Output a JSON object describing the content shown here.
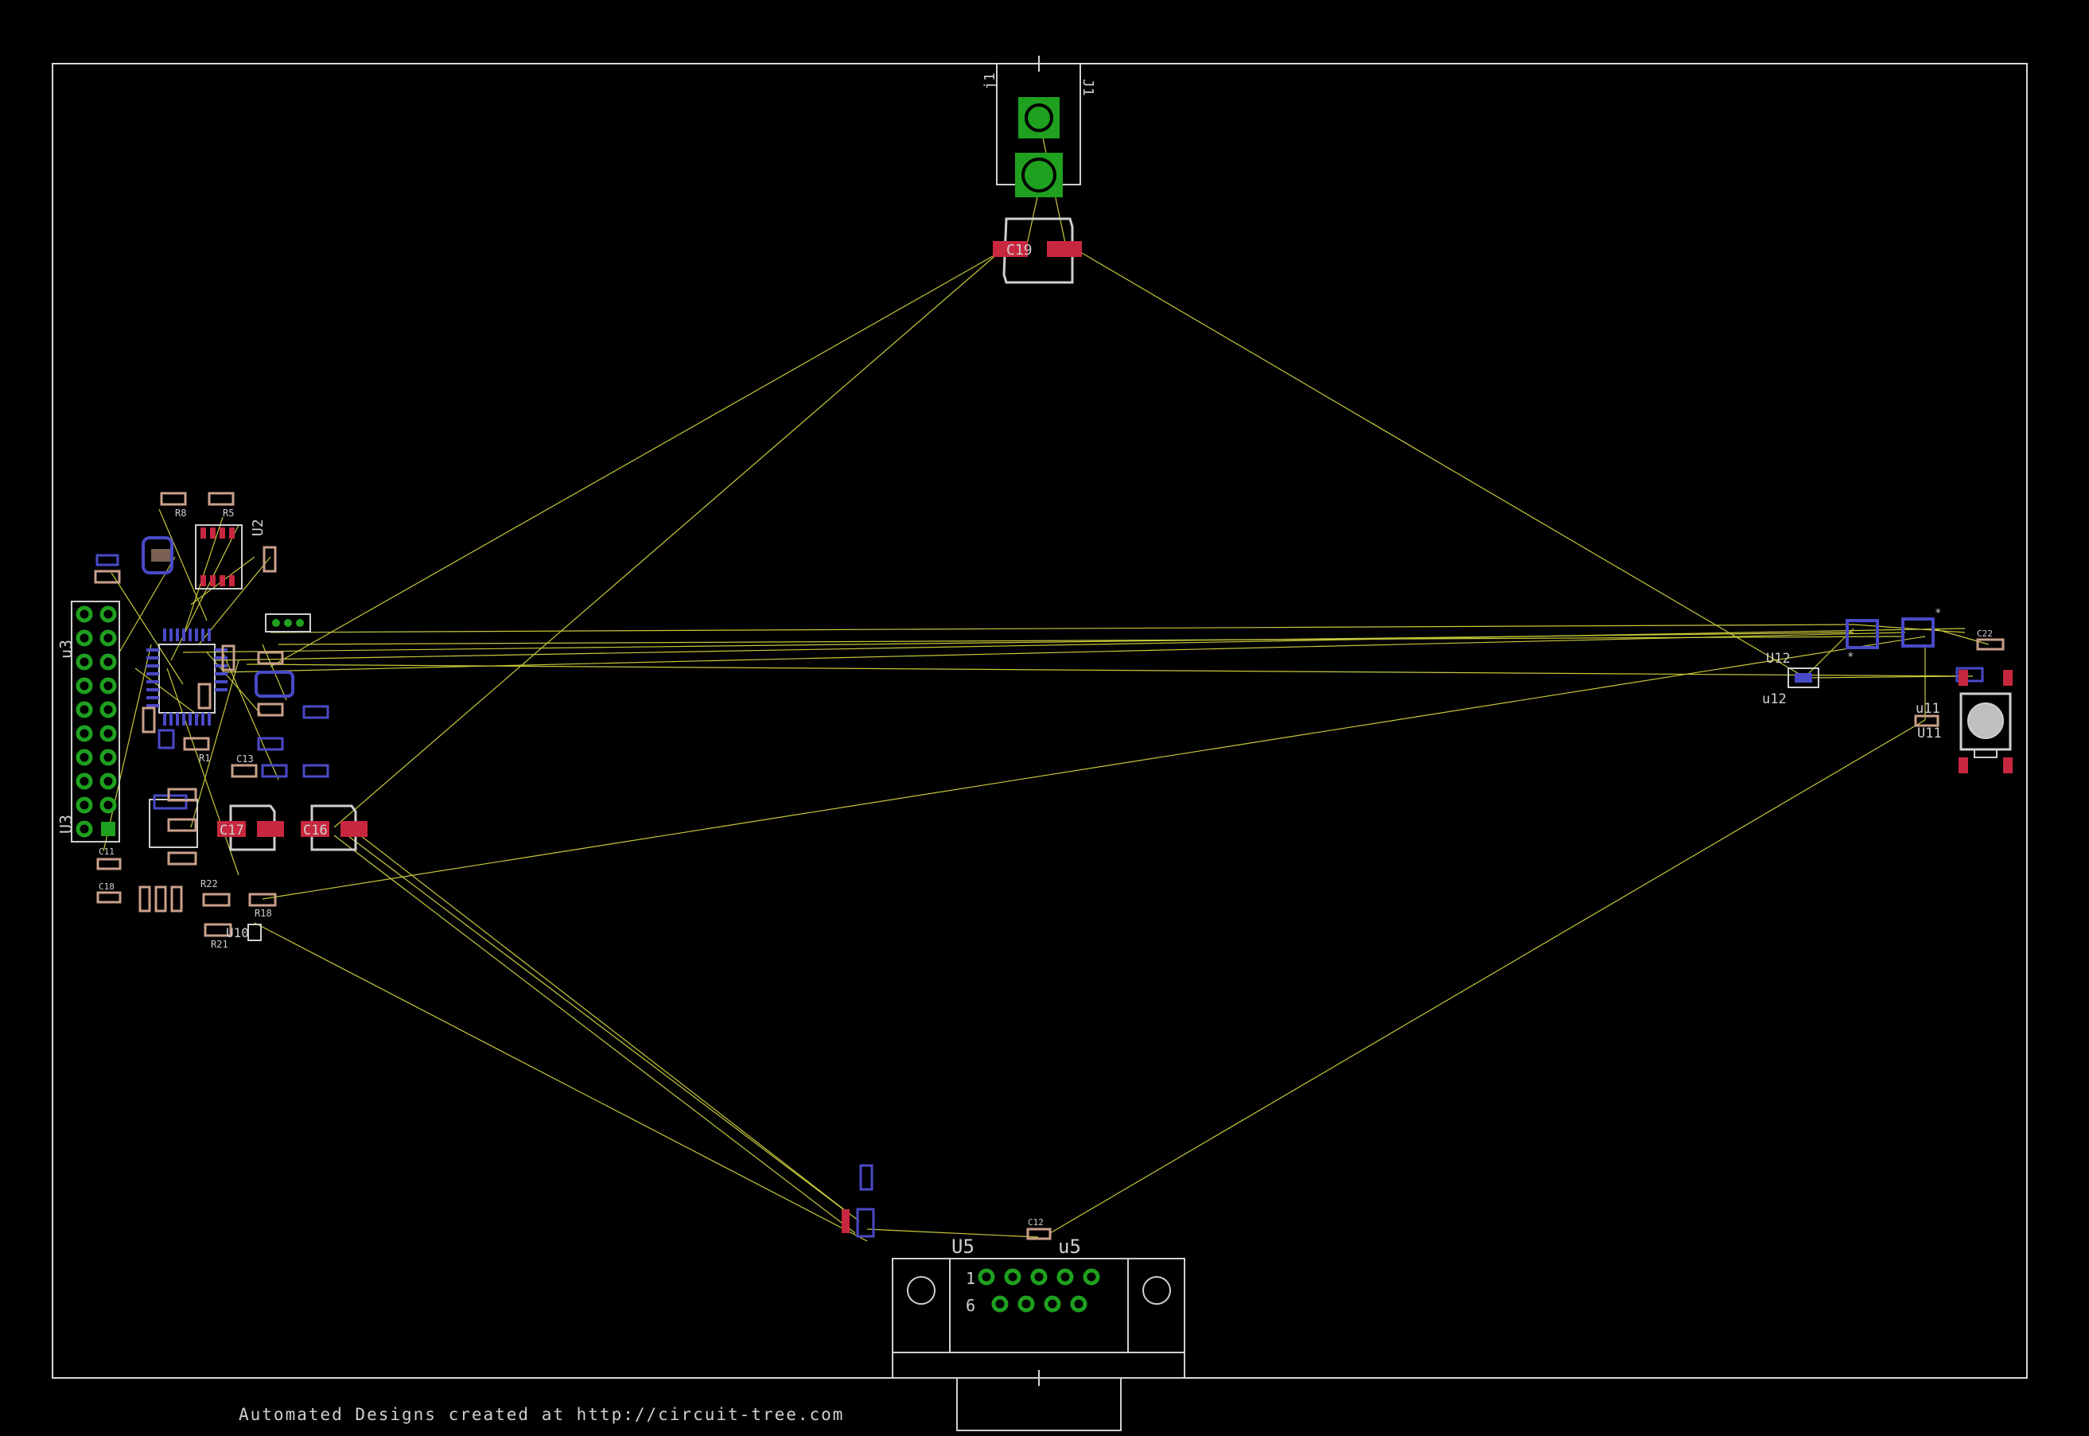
{
  "footer": "Automated Designs created at http://circuit-tree.com",
  "colors": {
    "background": "#000000",
    "outline": "#d8d8d8",
    "silkscreen": "#cfcfcf",
    "airwire": "#c8c83c",
    "top_pad": "#c8283f",
    "bottom_pad": "#4a4ac8",
    "through_hole": "#1fa01f",
    "smd_resistor": "#c9a08a"
  },
  "labels": {
    "j1_left": "j1",
    "j1_right": "J1",
    "c19": "C19",
    "c16": "C16",
    "c17": "C17",
    "u3_top": "u3",
    "u3_bottom": "U3",
    "u5_left": "U5",
    "u5_right": "u5",
    "u12_top": "U12",
    "u12_bottom": "u12",
    "u11_top": "u11",
    "u11_bottom": "U11",
    "u10": "U10",
    "u2": "U2",
    "r8": "R8",
    "r5": "R5",
    "r1": "R1",
    "r22": "R22",
    "r21": "R21",
    "r18": "R18",
    "c11": "C11",
    "c13": "C13",
    "c12": "C12",
    "c18": "C18",
    "c22": "C22",
    "db9_pin1": "1",
    "db9_pin6": "6"
  }
}
